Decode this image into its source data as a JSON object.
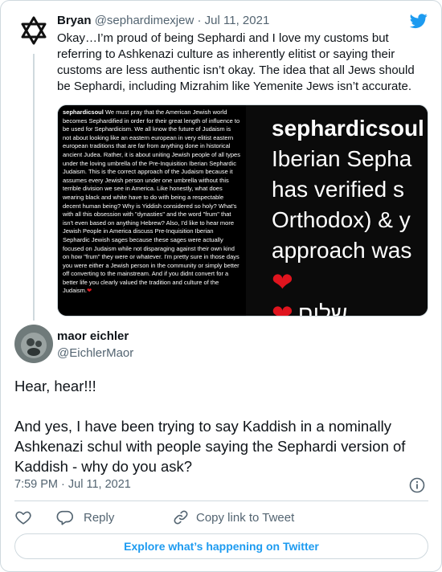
{
  "parent_tweet": {
    "author_name": "Bryan",
    "author_handle": "@sephardimexjew",
    "separator": "·",
    "date": "Jul 11, 2021",
    "text": "Okay…I’m proud of being Sephardi and I love my customs but referring to Ashkenazi culture as inherently elitist or saying their customs are less authentic isn’t okay. The idea that all Jews should be Sephardi, including Mizrahim like Yemenite Jews isn’t accurate.",
    "avatar_icon": "star-of-david-icon",
    "media": {
      "left_username": "sephardicsoul",
      "left_text": " We must pray that the American Jewish world becomes Sephardified in order for their great length of influence to be used for Sephardicism. We all know the future of Judaism is not about looking like an eastern european in very elitist eastern european traditions that are far from anything done in historical ancient Judea.  Rather, it is about uniting Jewish people of all types under the loving umbrella of the Pre-Inquisition Iberian Sephardic Judaism. This is the correct approach of the Judaism because it assumes every Jewish person under one umbrella without this terrible division we see in America. Like honestly, what does wearing black and white have to do with being a respectable decent human being? Why is Yiddish considered so holy? What's with all this obsession with \"dynasties\" and the word \"frum\" that isn't even based on anything Hebrew? Also, I'd like to hear more Jewish People in America discuss Pre-Inquisition Iberian Sephardic Jewish sages because these sages were actually focused on Judaism while not disparaging against their own kind on how \"frum\" they were or whatever. I'm pretty sure in those days you were either a Jewish person in the community or simply better off converting to the mainstream.  And if you didnt convert for a better life you clearly valued the tradition and culture of the Judaism.",
      "right_username": "sephardicsoul",
      "right_lines": [
        "Iberian Sepha",
        "has verified s",
        "Orthodox) & y",
        "approach was"
      ],
      "right_hebrew": "שלום"
    }
  },
  "main_tweet": {
    "author_name": "maor eichler",
    "author_handle": "@EichlerMaor",
    "text_line1": "Hear, hear!!!",
    "text_para2": "And yes, I have been trying to say Kaddish in a nominally Ashkenazi schul with people saying the Sephardi version of Kaddish - why do you ask?",
    "time": "7:59 PM",
    "separator": "·",
    "date": "Jul 11, 2021"
  },
  "actions": {
    "like_icon": "heart-outline-icon",
    "reply_label": "Reply",
    "copy_link_label": "Copy link to Tweet"
  },
  "explore_label": "Explore what’s happening on Twitter",
  "colors": {
    "brand_blue": "#1d9bf0",
    "secondary_text": "#536471",
    "border": "#cfd9de",
    "heart_red": "#e0141e"
  }
}
